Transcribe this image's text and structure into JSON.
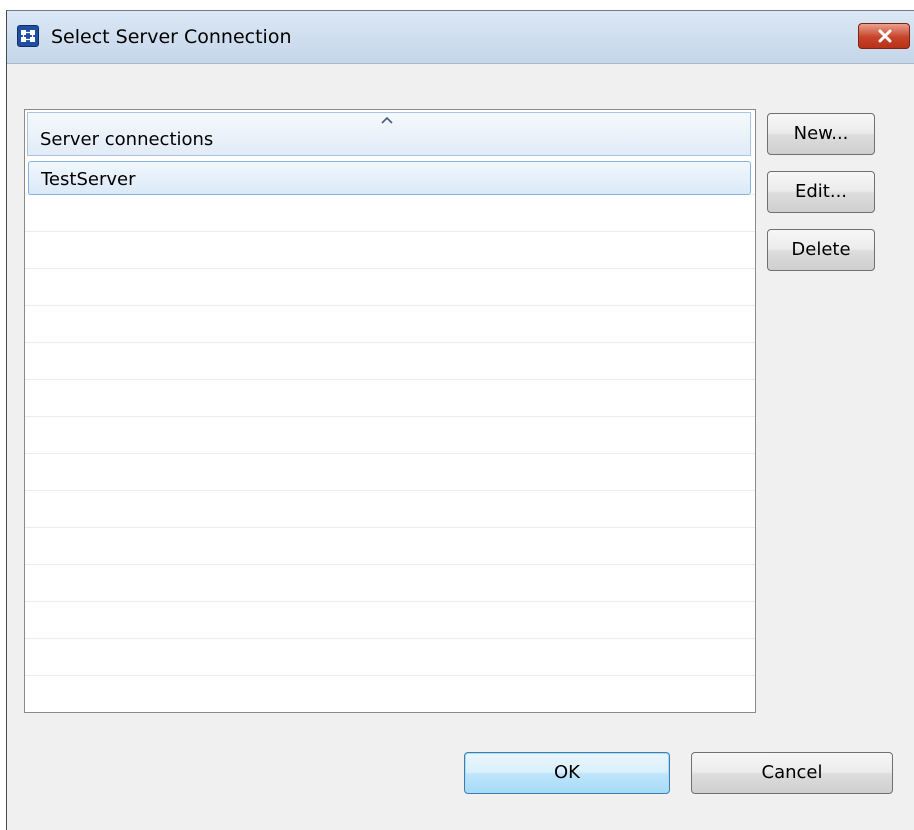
{
  "window": {
    "title": "Select Server Connection",
    "icon": "server-app-icon",
    "close_icon": "close-icon"
  },
  "list": {
    "column_header": "Server connections",
    "sort_indicator": "sort-ascending-icon",
    "rows": [
      {
        "name": "TestServer",
        "selected": true
      }
    ]
  },
  "side_buttons": {
    "new_label": "New...",
    "edit_label": "Edit...",
    "delete_label": "Delete"
  },
  "footer_buttons": {
    "ok_label": "OK",
    "cancel_label": "Cancel"
  },
  "colors": {
    "titlebar": "#c5d6ea",
    "close_button": "#c8432a",
    "selection": "#dbe9f8",
    "default_button_border": "#3c7fb1"
  }
}
